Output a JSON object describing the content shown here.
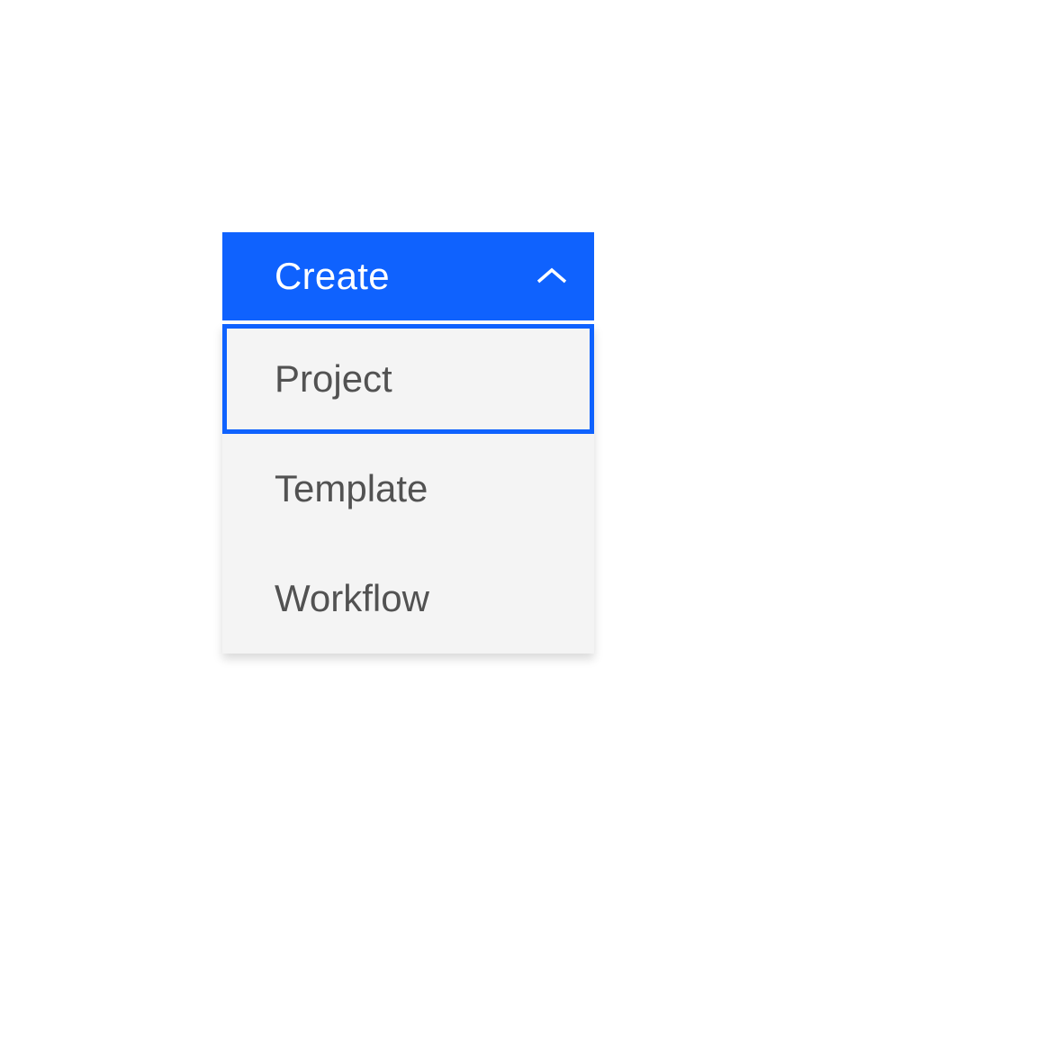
{
  "dropdown": {
    "label": "Create",
    "items": [
      {
        "label": "Project"
      },
      {
        "label": "Template"
      },
      {
        "label": "Workflow"
      }
    ]
  },
  "colors": {
    "primary": "#0F62FE",
    "menuBg": "#f4f4f4",
    "text": "#525252"
  }
}
